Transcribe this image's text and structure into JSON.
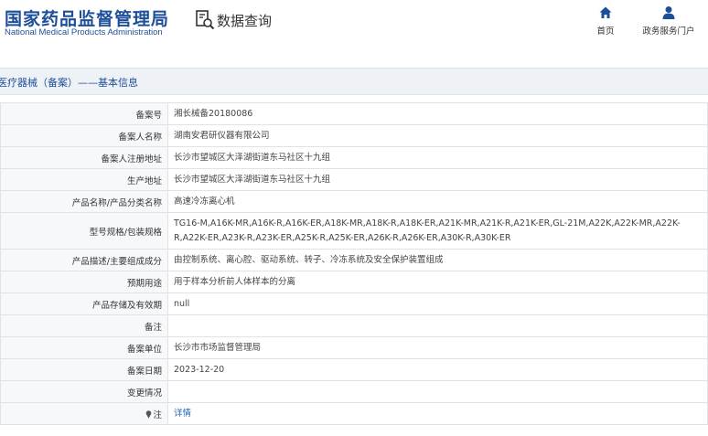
{
  "header": {
    "brand_cn": "国家药品监督管理局",
    "brand_en": "National Medical Products Administration",
    "query_label": "数据查询",
    "nav": [
      {
        "label": "首页",
        "icon": "home-icon"
      },
      {
        "label": "政务服务门户",
        "icon": "user-icon"
      }
    ]
  },
  "section": {
    "title": "医疗器械（备案）——基本信息"
  },
  "rows": [
    {
      "label": "备案号",
      "value": "湘长械备20180086"
    },
    {
      "label": "备案人名称",
      "value": "湖南安君研仪器有限公司"
    },
    {
      "label": "备案人注册地址",
      "value": "长沙市望城区大泽湖街道东马社区十九组"
    },
    {
      "label": "生产地址",
      "value": "长沙市望城区大泽湖街道东马社区十九组"
    },
    {
      "label": "产品名称/产品分类名称",
      "value": "高速冷冻离心机"
    },
    {
      "label": "型号规格/包装规格",
      "value": "TG16-M,A16K-MR,A16K-R,A16K-ER,A18K-MR,A18K-R,A18K-ER,A21K-MR,A21K-R,A21K-ER,GL-21M,A22K,A22K-MR,A22K-R,A22K-ER,A23K-R,A23K-ER,A25K-R,A25K-ER,A26K-R,A26K-ER,A30K-R,A30K-ER"
    },
    {
      "label": "产品描述/主要组成成分",
      "value": "由控制系统、离心腔、驱动系统、转子、冷冻系统及安全保护装置组成"
    },
    {
      "label": "预期用途",
      "value": "用于样本分析前人体样本的分离"
    },
    {
      "label": "产品存储及有效期",
      "value": "null"
    },
    {
      "label": "备注",
      "value": ""
    },
    {
      "label": "备案单位",
      "value": "长沙市市场监督管理局"
    },
    {
      "label": "备案日期",
      "value": "2023-12-20"
    },
    {
      "label": "变更情况",
      "value": ""
    },
    {
      "label": "注",
      "value": "详情",
      "icon": "pin-icon"
    }
  ],
  "colors": {
    "brand": "#1d4f99",
    "link": "#1d64b3",
    "label_bg": "#f7f8fa",
    "border": "#dfe3e8"
  }
}
